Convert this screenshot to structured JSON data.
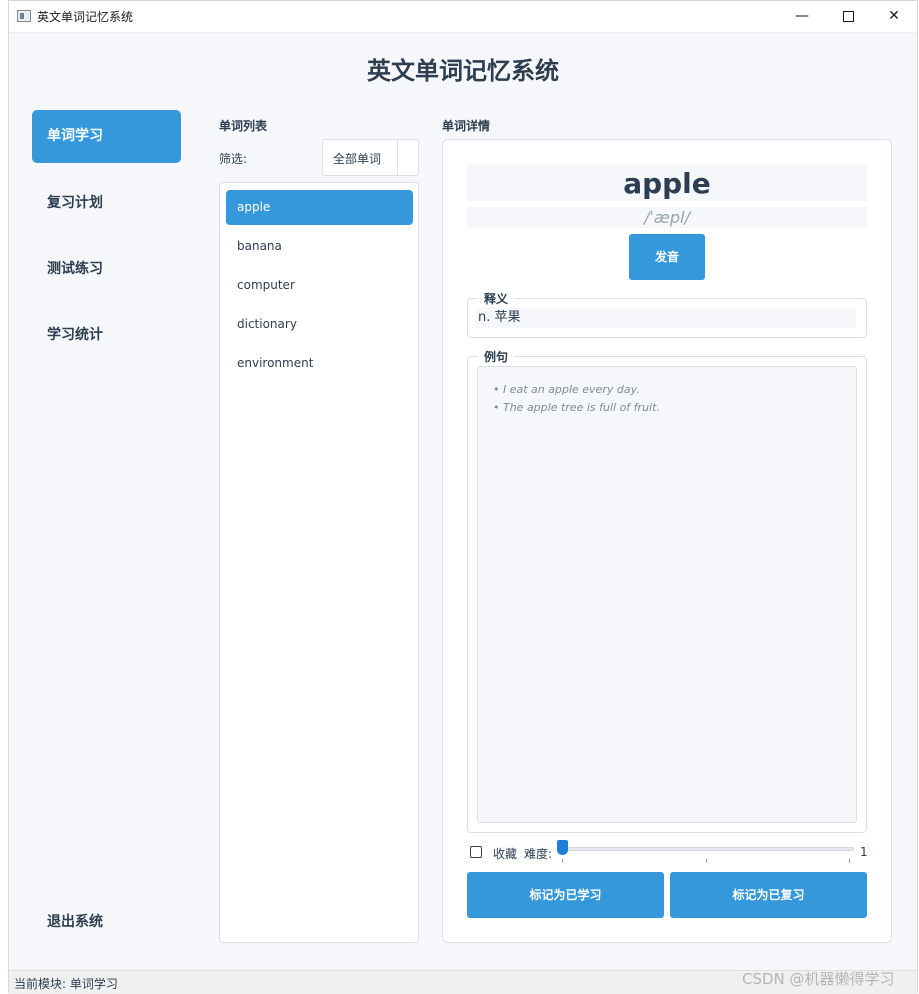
{
  "window": {
    "title": "英文单词记忆系统",
    "minimize": "—",
    "close": "✕"
  },
  "app_title": "英文单词记忆系统",
  "sidebar": {
    "items": [
      {
        "label": "单词学习",
        "active": true
      },
      {
        "label": "复习计划"
      },
      {
        "label": "测试练习"
      },
      {
        "label": "学习统计"
      }
    ],
    "exit_label": "退出系统"
  },
  "word_list": {
    "title": "单词列表",
    "filter_label": "筛选:",
    "filter_value": "全部单词",
    "words": [
      "apple",
      "banana",
      "computer",
      "dictionary",
      "environment"
    ],
    "selected": "apple"
  },
  "detail": {
    "title": "单词详情",
    "word": "apple",
    "phonetic": "/ˈæpl/",
    "pronounce_label": "发音",
    "meaning_title": "释义",
    "meaning": "n. 苹果",
    "examples_title": "例句",
    "examples": [
      "• I eat an apple every day.",
      "• The apple tree is full of fruit."
    ],
    "favorite_label": "收藏",
    "favorite_checked": false,
    "difficulty_label": "难度:",
    "difficulty": 1,
    "mark_learned_label": "标记为已学习",
    "mark_reviewed_label": "标记为已复习"
  },
  "status": "当前模块: 单词学习",
  "watermark": "CSDN @机器懒得学习",
  "colors": {
    "accent": "#3498db",
    "text": "#2c3e50",
    "background": "#f5f7fa"
  }
}
